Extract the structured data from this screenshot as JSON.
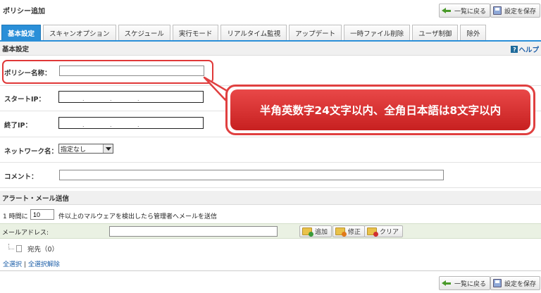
{
  "page": {
    "title": "ポリシー追加"
  },
  "toolbar": {
    "back_label": "一覧に戻る",
    "save_label": "設定を保存"
  },
  "tabs": [
    {
      "label": "基本設定",
      "active": true
    },
    {
      "label": "スキャンオプション"
    },
    {
      "label": "スケジュール"
    },
    {
      "label": "実行モード"
    },
    {
      "label": "リアルタイム監視"
    },
    {
      "label": "アップデート"
    },
    {
      "label": "一時ファイル削除"
    },
    {
      "label": "ユーザ制御"
    },
    {
      "label": "除外"
    }
  ],
  "basic": {
    "section_title": "基本設定",
    "help_label": "ヘルプ",
    "help_icon": "?",
    "policy_name_label": "ポリシー名称：",
    "policy_name_value": "",
    "start_ip_label": "スタートIP：",
    "end_ip_label": "終了IP：",
    "ip_separator": ".",
    "network_label": "ネットワーク名：",
    "network_selected": "指定なし",
    "comment_label": "コメント：",
    "comment_value": ""
  },
  "callout": {
    "text": "半角英数字24文字以内、全角日本語は8文字以内"
  },
  "alert": {
    "section_title": "アラート・メール送信",
    "prefix": "1 時間に",
    "count_value": "10",
    "suffix": "件以上のマルウェアを検出したら管理者へメールを送信",
    "email_label": "メールアドレス:",
    "email_value": "",
    "add_label": "追加",
    "edit_label": "修正",
    "clear_label": "クリア",
    "recipients_label": "宛先（0）",
    "select_all": "全選択",
    "link_separator": "|",
    "deselect_all": "全選択解除"
  },
  "colors": {
    "tab_active": "#2a8fd8",
    "callout": "#e04040",
    "link": "#1d5fa8"
  }
}
